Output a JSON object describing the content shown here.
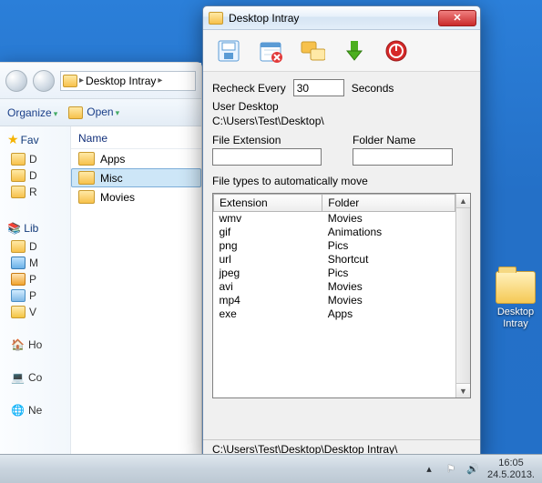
{
  "explorer": {
    "breadcrumb": "Desktop Intray",
    "cmd": {
      "organize": "Organize",
      "open": "Open"
    },
    "nav": {
      "fav_label": "Fav",
      "fav_items": [
        "D",
        "D",
        "R"
      ],
      "lib_label": "Lib",
      "lib_items": [
        "D",
        "M",
        "P",
        "P",
        "V"
      ],
      "other": [
        "Ho",
        "Co",
        "Ne"
      ]
    },
    "col_header": "Name",
    "rows": [
      "Apps",
      "Misc",
      "Movies"
    ],
    "selected_index": 1
  },
  "app": {
    "title": "Desktop Intray",
    "recheck_label": "Recheck Every",
    "recheck_value": "30",
    "seconds_label": "Seconds",
    "user_desktop_label": "User Desktop",
    "user_desktop_path": "C:\\Users\\Test\\Desktop\\",
    "file_ext_label": "File Extension",
    "folder_name_label": "Folder Name",
    "file_ext_value": "",
    "folder_name_value": "",
    "types_label": "File types to automatically move",
    "table": {
      "headers": [
        "Extension",
        "Folder"
      ],
      "rows": [
        [
          "wmv",
          "Movies"
        ],
        [
          "gif",
          "Animations"
        ],
        [
          "png",
          "Pics"
        ],
        [
          "url",
          "Shortcut"
        ],
        [
          "jpeg",
          "Pics"
        ],
        [
          "avi",
          "Movies"
        ],
        [
          "mp4",
          "Movies"
        ],
        [
          "exe",
          "Apps"
        ]
      ]
    },
    "status_path": "C:\\Users\\Test\\Desktop\\Desktop Intray\\"
  },
  "desktop_icon": {
    "line1": "Desktop",
    "line2": "Intray"
  },
  "taskbar": {
    "time": "16:05",
    "date": "24.5.2013."
  },
  "icons": {
    "save": "save-icon",
    "calendar_x": "calendar-x-icon",
    "folders": "folders-icon",
    "download": "download-arrow-icon",
    "power": "power-icon",
    "flag": "flag-icon",
    "speaker": "speaker-icon",
    "chevron_up": "chevron-up-icon"
  }
}
